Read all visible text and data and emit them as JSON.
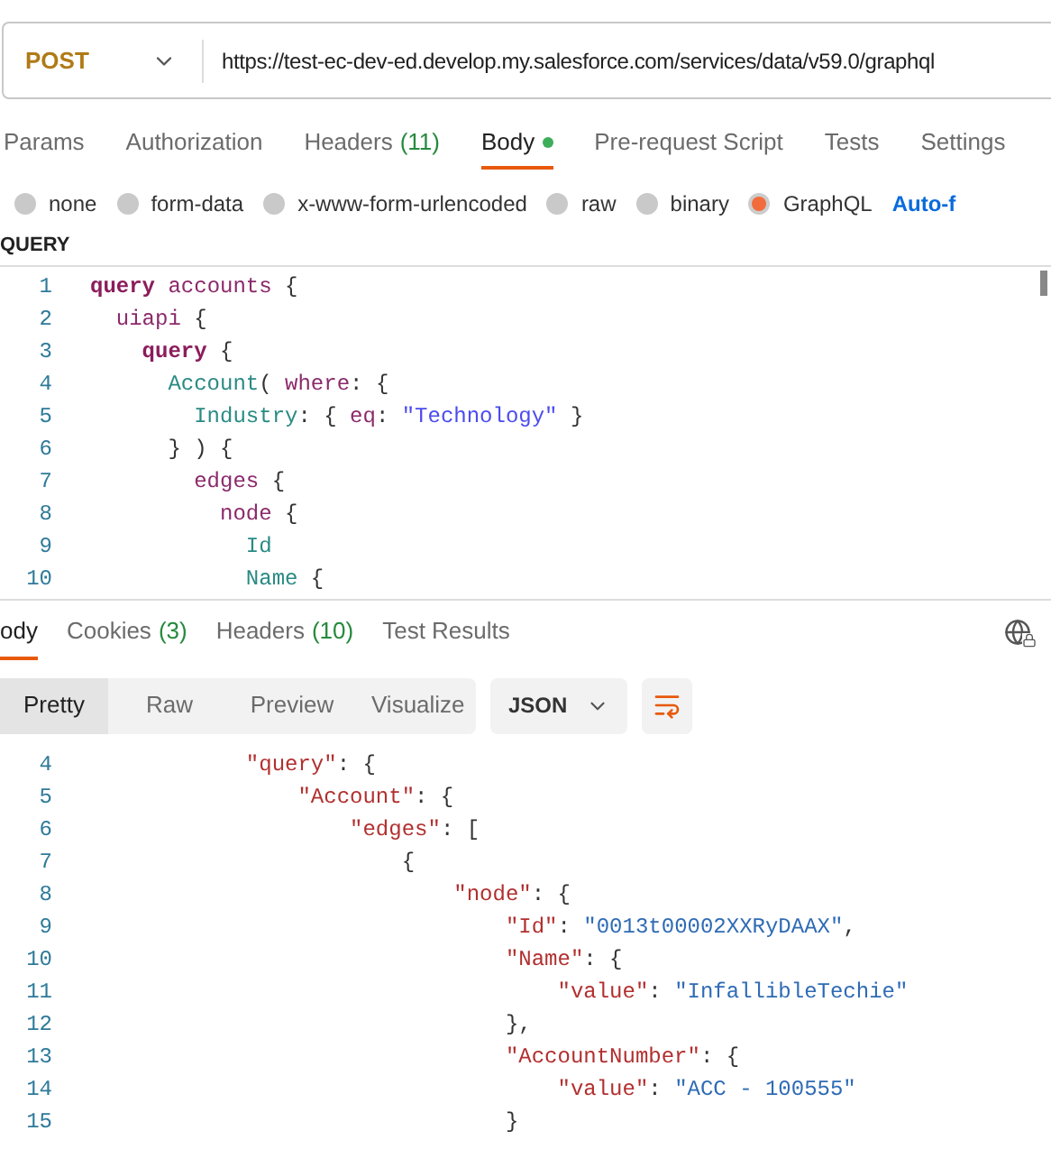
{
  "request": {
    "method": "POST",
    "url": "https://test-ec-dev-ed.develop.my.salesforce.com/services/data/v59.0/graphql"
  },
  "request_tabs": [
    {
      "label": "Params",
      "selected": false
    },
    {
      "label": "Authorization",
      "selected": false
    },
    {
      "label": "Headers",
      "count": "(11)",
      "selected": false
    },
    {
      "label": "Body",
      "dot": true,
      "selected": true
    },
    {
      "label": "Pre-request Script",
      "selected": false
    },
    {
      "label": "Tests",
      "selected": false
    },
    {
      "label": "Settings",
      "selected": false
    }
  ],
  "body_types": [
    {
      "label": "none",
      "selected": false
    },
    {
      "label": "form-data",
      "selected": false
    },
    {
      "label": "x-www-form-urlencoded",
      "selected": false
    },
    {
      "label": "raw",
      "selected": false
    },
    {
      "label": "binary",
      "selected": false
    },
    {
      "label": "GraphQL",
      "selected": true
    }
  ],
  "auto_fetch_link": "Auto-f",
  "query_label": "QUERY",
  "query_lines": [
    {
      "num": "1",
      "tokens": [
        {
          "text": "query",
          "kind": "keyword"
        },
        {
          "text": " accounts ",
          "kind": "name"
        },
        {
          "text": "{",
          "kind": "punct"
        }
      ]
    },
    {
      "num": "2",
      "tokens": [
        {
          "text": "  uiapi",
          "kind": "name"
        },
        {
          "text": " {",
          "kind": "punct"
        }
      ]
    },
    {
      "num": "3",
      "tokens": [
        {
          "text": "    query",
          "kind": "keyword"
        },
        {
          "text": " {",
          "kind": "punct"
        }
      ]
    },
    {
      "num": "4",
      "tokens": [
        {
          "text": "      Account",
          "kind": "field"
        },
        {
          "text": "( ",
          "kind": "punct"
        },
        {
          "text": "where",
          "kind": "name"
        },
        {
          "text": ": {",
          "kind": "punct"
        }
      ]
    },
    {
      "num": "5",
      "tokens": [
        {
          "text": "        Industry",
          "kind": "field"
        },
        {
          "text": ": { ",
          "kind": "punct"
        },
        {
          "text": "eq",
          "kind": "name"
        },
        {
          "text": ": ",
          "kind": "punct"
        },
        {
          "text": "\"Technology\"",
          "kind": "string"
        },
        {
          "text": " }",
          "kind": "punct"
        }
      ]
    },
    {
      "num": "6",
      "tokens": [
        {
          "text": "      } ) {",
          "kind": "punct"
        }
      ]
    },
    {
      "num": "7",
      "tokens": [
        {
          "text": "        edges",
          "kind": "name"
        },
        {
          "text": " {",
          "kind": "punct"
        }
      ]
    },
    {
      "num": "8",
      "tokens": [
        {
          "text": "          node",
          "kind": "name"
        },
        {
          "text": " {",
          "kind": "punct"
        }
      ]
    },
    {
      "num": "9",
      "tokens": [
        {
          "text": "            Id",
          "kind": "field"
        }
      ]
    },
    {
      "num": "10",
      "tokens": [
        {
          "text": "            Name",
          "kind": "field"
        },
        {
          "text": " {",
          "kind": "punct"
        }
      ]
    }
  ],
  "response_tabs": [
    {
      "label": "ody",
      "selected": true
    },
    {
      "label": "Cookies",
      "count": "(3)",
      "selected": false
    },
    {
      "label": "Headers",
      "count": "(10)",
      "selected": false
    },
    {
      "label": "Test Results",
      "selected": false
    }
  ],
  "view_modes": [
    {
      "label": "Pretty",
      "selected": true
    },
    {
      "label": "Raw",
      "selected": false
    },
    {
      "label": "Preview",
      "selected": false
    },
    {
      "label": "Visualize",
      "selected": false
    }
  ],
  "format": "JSON",
  "wrap_enabled": true,
  "response_lines": [
    {
      "num": "4",
      "tokens": [
        {
          "text": "            \"query\"",
          "kind": "key"
        },
        {
          "text": ": {",
          "kind": "punct"
        }
      ]
    },
    {
      "num": "5",
      "tokens": [
        {
          "text": "                \"Account\"",
          "kind": "key"
        },
        {
          "text": ": {",
          "kind": "punct"
        }
      ]
    },
    {
      "num": "6",
      "tokens": [
        {
          "text": "                    \"edges\"",
          "kind": "key"
        },
        {
          "text": ": [",
          "kind": "punct"
        }
      ]
    },
    {
      "num": "7",
      "tokens": [
        {
          "text": "                        {",
          "kind": "punct"
        }
      ]
    },
    {
      "num": "8",
      "tokens": [
        {
          "text": "                            \"node\"",
          "kind": "key"
        },
        {
          "text": ": {",
          "kind": "punct"
        }
      ]
    },
    {
      "num": "9",
      "tokens": [
        {
          "text": "                                \"Id\"",
          "kind": "key"
        },
        {
          "text": ": ",
          "kind": "punct"
        },
        {
          "text": "\"0013t00002XXRyDAAX\"",
          "kind": "value"
        },
        {
          "text": ",",
          "kind": "punct"
        }
      ]
    },
    {
      "num": "10",
      "tokens": [
        {
          "text": "                                \"Name\"",
          "kind": "key"
        },
        {
          "text": ": {",
          "kind": "punct"
        }
      ]
    },
    {
      "num": "11",
      "tokens": [
        {
          "text": "                                    \"value\"",
          "kind": "key"
        },
        {
          "text": ": ",
          "kind": "punct"
        },
        {
          "text": "\"InfallibleTechie\"",
          "kind": "value"
        }
      ]
    },
    {
      "num": "12",
      "tokens": [
        {
          "text": "                                },",
          "kind": "punct"
        }
      ]
    },
    {
      "num": "13",
      "tokens": [
        {
          "text": "                                \"AccountNumber\"",
          "kind": "key"
        },
        {
          "text": ": {",
          "kind": "punct"
        }
      ]
    },
    {
      "num": "14",
      "tokens": [
        {
          "text": "                                    \"value\"",
          "kind": "key"
        },
        {
          "text": ": ",
          "kind": "punct"
        },
        {
          "text": "\"ACC - 100555\"",
          "kind": "value"
        }
      ]
    },
    {
      "num": "15",
      "tokens": [
        {
          "text": "                                }",
          "kind": "punct"
        }
      ]
    }
  ]
}
